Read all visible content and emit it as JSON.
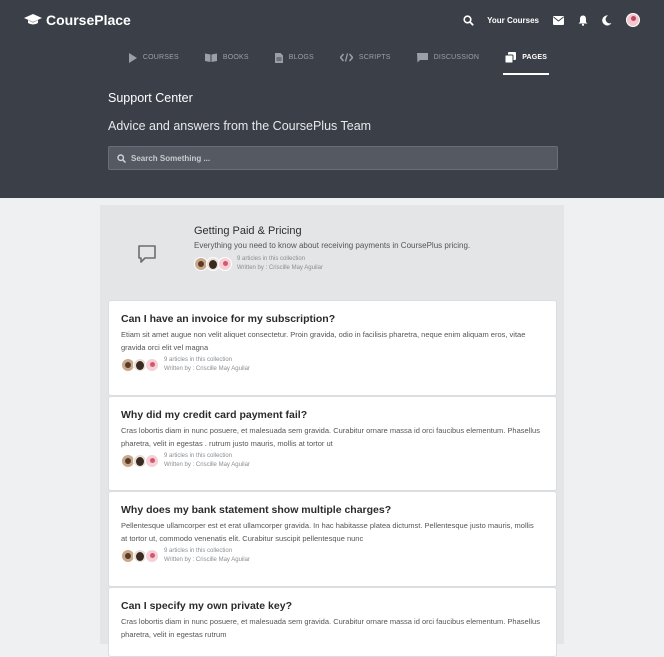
{
  "brand": {
    "name": "CoursePlace"
  },
  "topbar": {
    "your_courses": "Your Courses"
  },
  "nav": [
    {
      "label": "COURSES",
      "icon": "play-icon",
      "active": false
    },
    {
      "label": "BOOKS",
      "icon": "book-icon",
      "active": false
    },
    {
      "label": "BLOGS",
      "icon": "document-icon",
      "active": false
    },
    {
      "label": "SCRIPTS",
      "icon": "code-icon",
      "active": false
    },
    {
      "label": "DISCUSSION",
      "icon": "chat-icon",
      "active": false
    },
    {
      "label": "PAGES",
      "icon": "pages-icon",
      "active": true
    }
  ],
  "hero": {
    "title": "Support Center",
    "subtitle": "Advice and answers from the CoursePlus Team",
    "search_placeholder": "Search Something ..."
  },
  "collection": {
    "title": "Getting Paid & Pricing",
    "description": "Everything you need to know about receiving payments in CoursePlus pricing.",
    "count": "9 articles in this collection",
    "author": "Written by : Criscille May Aguilar"
  },
  "articles": [
    {
      "title": "Can I have an invoice for my subscription?",
      "body": "Etiam sit amet augue non velit aliquet consectetur. Proin gravida, odio in facilisis pharetra, neque enim aliquam eros, vitae gravida orci elit vel magna",
      "count": "9 articles in this collection",
      "author": "Written by : Criscille May Aguilar"
    },
    {
      "title": "Why did my credit card payment fail?",
      "body": "Cras lobortis diam in nunc posuere, et malesuada sem gravida. Curabitur ornare massa id orci faucibus elementum. Phasellus pharetra, velit in egestas . rutrum justo mauris, mollis at tortor ut",
      "count": "9 articles in this collection",
      "author": "Written by : Criscille May Aguilar"
    },
    {
      "title": "Why does my bank statement show multiple charges?",
      "body": "Pellentesque ullamcorper est et erat ullamcorper gravida. In hac habitasse platea dictumst. Pellentesque justo mauris, mollis at tortor ut, commodo venenatis elit. Curabitur suscipit pellentesque nunc",
      "count": "9 articles in this collection",
      "author": "Written by : Criscille May Aguilar"
    },
    {
      "title": "Can I specify my own private key?",
      "body": "Cras lobortis diam in nunc posuere, et malesuada sem gravida. Curabitur ornare massa id orci faucibus elementum. Phasellus pharetra, velit in egestas rutrum",
      "count": "",
      "author": ""
    }
  ],
  "colors": {
    "header_bg": "#3b4048",
    "page_bg": "#eef0f2",
    "panel_bg": "#e4e5e7"
  }
}
